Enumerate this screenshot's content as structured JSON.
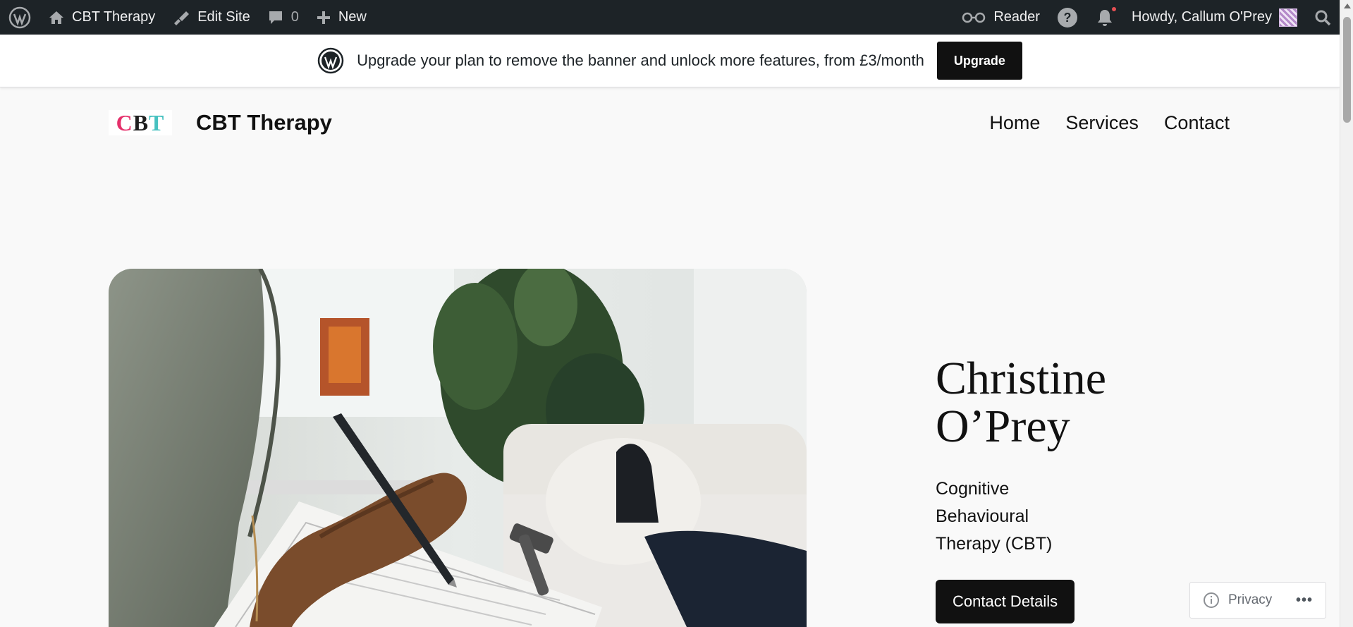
{
  "adminbar": {
    "site_name": "CBT Therapy",
    "edit_site": "Edit Site",
    "comments_count": "0",
    "new": "New",
    "reader": "Reader",
    "howdy": "Howdy, Callum O'Prey"
  },
  "banner": {
    "text": "Upgrade your plan to remove the banner and unlock more features, from £3/month",
    "button": "Upgrade"
  },
  "header": {
    "logo_letters": [
      "C",
      "B",
      "T"
    ],
    "title": "CBT Therapy",
    "nav": [
      "Home",
      "Services",
      "Contact"
    ]
  },
  "hero": {
    "name_line1": "Christine",
    "name_line2": "O’Prey",
    "subtitle_lines": [
      "Cognitive",
      "Behavioural",
      "Therapy (CBT)"
    ],
    "button": "Contact Details"
  },
  "privacy": {
    "label": "Privacy",
    "more": "•••"
  },
  "colors": {
    "adminbar_bg": "#1d2327",
    "logo_c": "#e5306b",
    "logo_t": "#47c1c0",
    "button_bg": "#111111"
  }
}
